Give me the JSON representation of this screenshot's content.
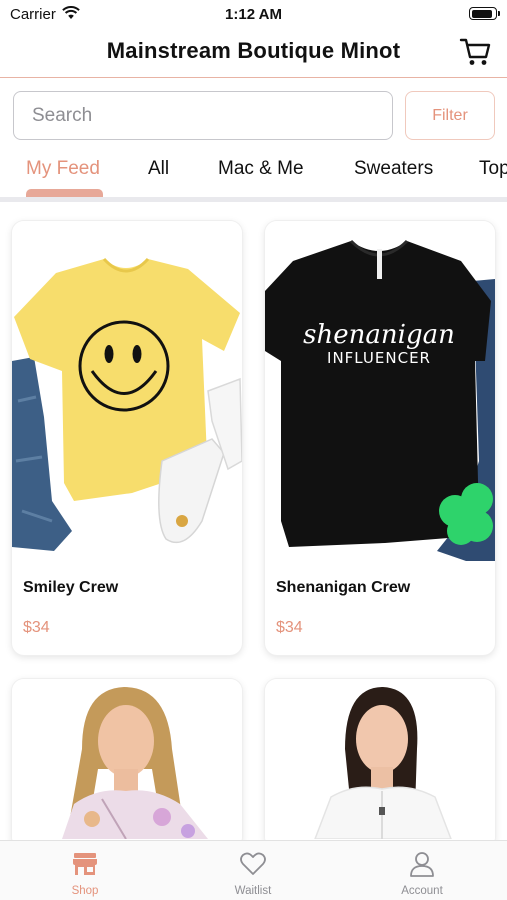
{
  "status_bar": {
    "carrier": "Carrier",
    "time": "1:12 AM"
  },
  "header": {
    "title": "Mainstream Boutique Minot"
  },
  "search": {
    "placeholder": "Search",
    "filter_label": "Filter"
  },
  "category_tabs": [
    {
      "label": "My Feed",
      "active": true
    },
    {
      "label": "All"
    },
    {
      "label": "Mac & Me"
    },
    {
      "label": "Sweaters"
    },
    {
      "label": "Top"
    }
  ],
  "products": [
    {
      "name": "Smiley Crew",
      "price": "$34",
      "image": "yellow-smiley-tshirt"
    },
    {
      "name": "Shenanigan Crew",
      "price": "$34",
      "image": "black-shenanigan-tshirt",
      "print_line1": "shenanigan",
      "print_line2": "INFLUENCER"
    },
    {
      "name": "",
      "price": "",
      "image": "model-floral-top"
    },
    {
      "name": "",
      "price": "",
      "image": "model-white-top"
    }
  ],
  "tab_bar": [
    {
      "label": "Shop",
      "icon": "storefront-icon",
      "active": true
    },
    {
      "label": "Waitlist",
      "icon": "heart-icon"
    },
    {
      "label": "Account",
      "icon": "person-icon"
    }
  ],
  "colors": {
    "accent": "#e4937c",
    "divider": "#e8b3a4"
  }
}
